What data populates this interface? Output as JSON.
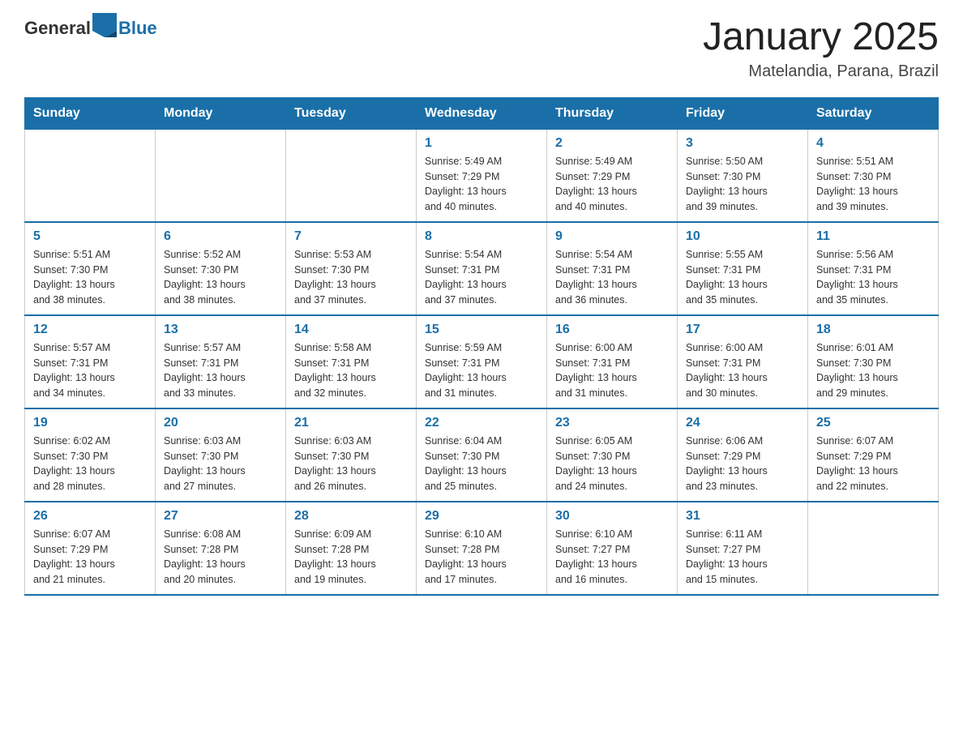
{
  "logo": {
    "general": "General",
    "blue": "Blue"
  },
  "header": {
    "month_title": "January 2025",
    "location": "Matelandia, Parana, Brazil"
  },
  "days_of_week": [
    "Sunday",
    "Monday",
    "Tuesday",
    "Wednesday",
    "Thursday",
    "Friday",
    "Saturday"
  ],
  "weeks": [
    [
      {
        "day": "",
        "info": ""
      },
      {
        "day": "",
        "info": ""
      },
      {
        "day": "",
        "info": ""
      },
      {
        "day": "1",
        "info": "Sunrise: 5:49 AM\nSunset: 7:29 PM\nDaylight: 13 hours\nand 40 minutes."
      },
      {
        "day": "2",
        "info": "Sunrise: 5:49 AM\nSunset: 7:29 PM\nDaylight: 13 hours\nand 40 minutes."
      },
      {
        "day": "3",
        "info": "Sunrise: 5:50 AM\nSunset: 7:30 PM\nDaylight: 13 hours\nand 39 minutes."
      },
      {
        "day": "4",
        "info": "Sunrise: 5:51 AM\nSunset: 7:30 PM\nDaylight: 13 hours\nand 39 minutes."
      }
    ],
    [
      {
        "day": "5",
        "info": "Sunrise: 5:51 AM\nSunset: 7:30 PM\nDaylight: 13 hours\nand 38 minutes."
      },
      {
        "day": "6",
        "info": "Sunrise: 5:52 AM\nSunset: 7:30 PM\nDaylight: 13 hours\nand 38 minutes."
      },
      {
        "day": "7",
        "info": "Sunrise: 5:53 AM\nSunset: 7:30 PM\nDaylight: 13 hours\nand 37 minutes."
      },
      {
        "day": "8",
        "info": "Sunrise: 5:54 AM\nSunset: 7:31 PM\nDaylight: 13 hours\nand 37 minutes."
      },
      {
        "day": "9",
        "info": "Sunrise: 5:54 AM\nSunset: 7:31 PM\nDaylight: 13 hours\nand 36 minutes."
      },
      {
        "day": "10",
        "info": "Sunrise: 5:55 AM\nSunset: 7:31 PM\nDaylight: 13 hours\nand 35 minutes."
      },
      {
        "day": "11",
        "info": "Sunrise: 5:56 AM\nSunset: 7:31 PM\nDaylight: 13 hours\nand 35 minutes."
      }
    ],
    [
      {
        "day": "12",
        "info": "Sunrise: 5:57 AM\nSunset: 7:31 PM\nDaylight: 13 hours\nand 34 minutes."
      },
      {
        "day": "13",
        "info": "Sunrise: 5:57 AM\nSunset: 7:31 PM\nDaylight: 13 hours\nand 33 minutes."
      },
      {
        "day": "14",
        "info": "Sunrise: 5:58 AM\nSunset: 7:31 PM\nDaylight: 13 hours\nand 32 minutes."
      },
      {
        "day": "15",
        "info": "Sunrise: 5:59 AM\nSunset: 7:31 PM\nDaylight: 13 hours\nand 31 minutes."
      },
      {
        "day": "16",
        "info": "Sunrise: 6:00 AM\nSunset: 7:31 PM\nDaylight: 13 hours\nand 31 minutes."
      },
      {
        "day": "17",
        "info": "Sunrise: 6:00 AM\nSunset: 7:31 PM\nDaylight: 13 hours\nand 30 minutes."
      },
      {
        "day": "18",
        "info": "Sunrise: 6:01 AM\nSunset: 7:30 PM\nDaylight: 13 hours\nand 29 minutes."
      }
    ],
    [
      {
        "day": "19",
        "info": "Sunrise: 6:02 AM\nSunset: 7:30 PM\nDaylight: 13 hours\nand 28 minutes."
      },
      {
        "day": "20",
        "info": "Sunrise: 6:03 AM\nSunset: 7:30 PM\nDaylight: 13 hours\nand 27 minutes."
      },
      {
        "day": "21",
        "info": "Sunrise: 6:03 AM\nSunset: 7:30 PM\nDaylight: 13 hours\nand 26 minutes."
      },
      {
        "day": "22",
        "info": "Sunrise: 6:04 AM\nSunset: 7:30 PM\nDaylight: 13 hours\nand 25 minutes."
      },
      {
        "day": "23",
        "info": "Sunrise: 6:05 AM\nSunset: 7:30 PM\nDaylight: 13 hours\nand 24 minutes."
      },
      {
        "day": "24",
        "info": "Sunrise: 6:06 AM\nSunset: 7:29 PM\nDaylight: 13 hours\nand 23 minutes."
      },
      {
        "day": "25",
        "info": "Sunrise: 6:07 AM\nSunset: 7:29 PM\nDaylight: 13 hours\nand 22 minutes."
      }
    ],
    [
      {
        "day": "26",
        "info": "Sunrise: 6:07 AM\nSunset: 7:29 PM\nDaylight: 13 hours\nand 21 minutes."
      },
      {
        "day": "27",
        "info": "Sunrise: 6:08 AM\nSunset: 7:28 PM\nDaylight: 13 hours\nand 20 minutes."
      },
      {
        "day": "28",
        "info": "Sunrise: 6:09 AM\nSunset: 7:28 PM\nDaylight: 13 hours\nand 19 minutes."
      },
      {
        "day": "29",
        "info": "Sunrise: 6:10 AM\nSunset: 7:28 PM\nDaylight: 13 hours\nand 17 minutes."
      },
      {
        "day": "30",
        "info": "Sunrise: 6:10 AM\nSunset: 7:27 PM\nDaylight: 13 hours\nand 16 minutes."
      },
      {
        "day": "31",
        "info": "Sunrise: 6:11 AM\nSunset: 7:27 PM\nDaylight: 13 hours\nand 15 minutes."
      },
      {
        "day": "",
        "info": ""
      }
    ]
  ]
}
